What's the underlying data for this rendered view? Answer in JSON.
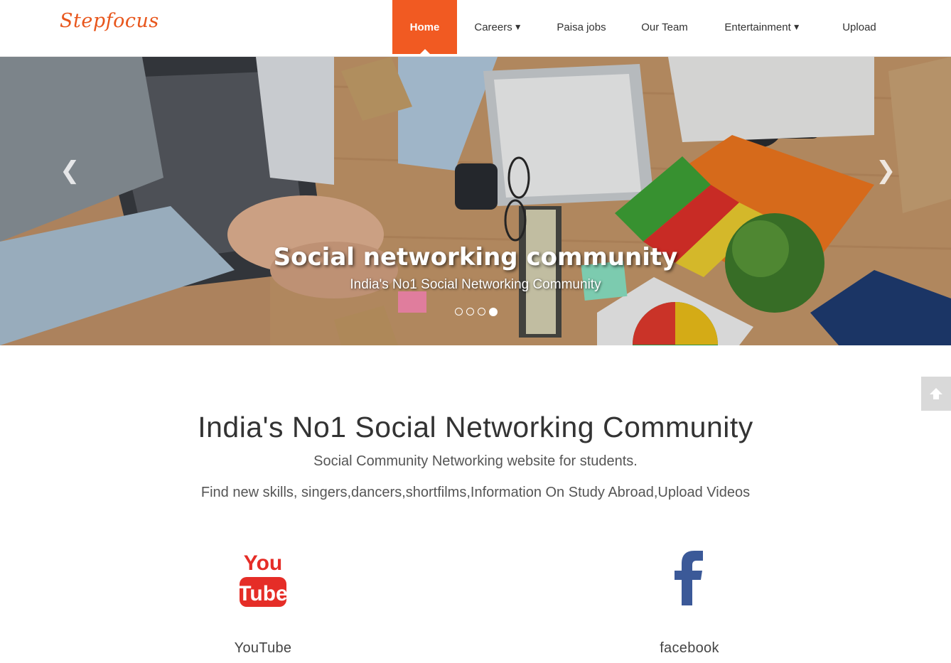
{
  "header": {
    "logo_text": "Stepfocus",
    "nav": [
      {
        "label": "Home",
        "active": true,
        "dropdown": false
      },
      {
        "label": "Careers",
        "active": false,
        "dropdown": true
      },
      {
        "label": "Paisa jobs",
        "active": false,
        "dropdown": false
      },
      {
        "label": "Our Team",
        "active": false,
        "dropdown": false
      },
      {
        "label": "Entertainment",
        "active": false,
        "dropdown": true
      },
      {
        "label": "Upload",
        "active": false,
        "dropdown": false
      }
    ],
    "caret": "▼",
    "accent_color": "#f15a22"
  },
  "hero": {
    "title": "Social networking community",
    "subtitle": "India's No1 Social Networking Community",
    "slide_count": 4,
    "active_slide": 4,
    "prev_icon": "chevron-left-icon",
    "next_icon": "chevron-right-icon"
  },
  "main": {
    "heading": "India's No1 Social Networking Community",
    "subtext1": "Social Community Networking website for students.",
    "subtext2": "Find new skills, singers,dancers,shortfilms,Information On Study Abroad,Upload Videos"
  },
  "social": [
    {
      "label": "YouTube",
      "icon": "youtube-icon",
      "icon_text_top": "You",
      "icon_text_bottom": "Tube",
      "color": "#e52d27"
    },
    {
      "label": "facebook",
      "icon": "facebook-icon",
      "color": "#3b5998"
    }
  ],
  "back_to_top_icon": "arrow-up-icon"
}
